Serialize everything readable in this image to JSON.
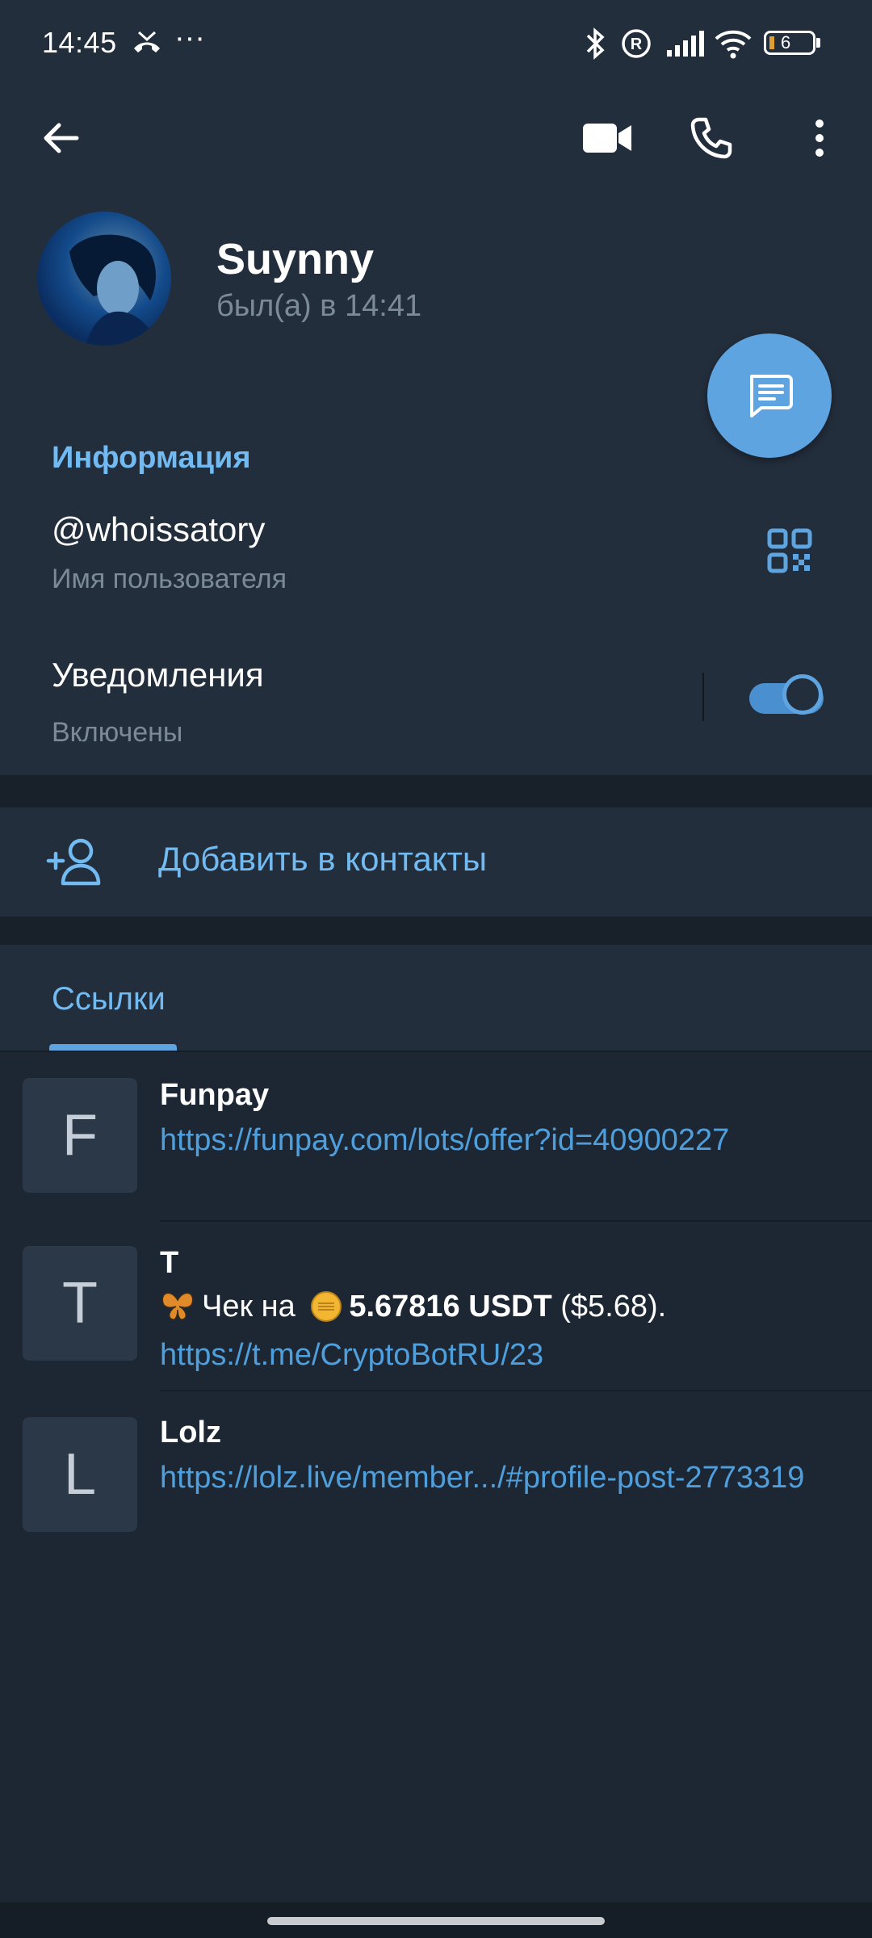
{
  "status_bar": {
    "time": "14:45",
    "missed_call_icon": "phone-missed-icon",
    "more": "···",
    "battery": "6"
  },
  "toolbar": {
    "back_icon": "arrow-left-icon",
    "video_icon": "video-call-icon",
    "call_icon": "phone-icon",
    "menu_icon": "more-vert-icon"
  },
  "profile": {
    "name": "Suynny",
    "last_seen": "был(а) в 14:41"
  },
  "info": {
    "title": "Информация",
    "username": "@whoissatory",
    "username_label": "Имя пользователя",
    "notifications": "Уведомления",
    "notifications_status": "Включены",
    "notifications_enabled": true
  },
  "add_contact": {
    "label": "Добавить в контакты"
  },
  "tabs": {
    "links_label": "Ссылки"
  },
  "links": [
    {
      "letter": "F",
      "title": "Funpay",
      "url": "https://funpay.com/lots/offer?id=40900227"
    },
    {
      "letter": "T",
      "title": "T",
      "text_prefix": "Чек на",
      "text_amount": "5.67816 USDT",
      "text_suffix": "($5.68).",
      "url": "https://t.me/CryptoBotRU/23"
    },
    {
      "letter": "L",
      "title": "Lolz",
      "url": "https://lolz.live/member.../#profile-post-2773319"
    }
  ],
  "colors": {
    "accent": "#71baf2",
    "link": "#4f9fdc",
    "header_bg": "#232e3c",
    "page_bg": "#1d2733",
    "fab": "#5ea4e0"
  }
}
